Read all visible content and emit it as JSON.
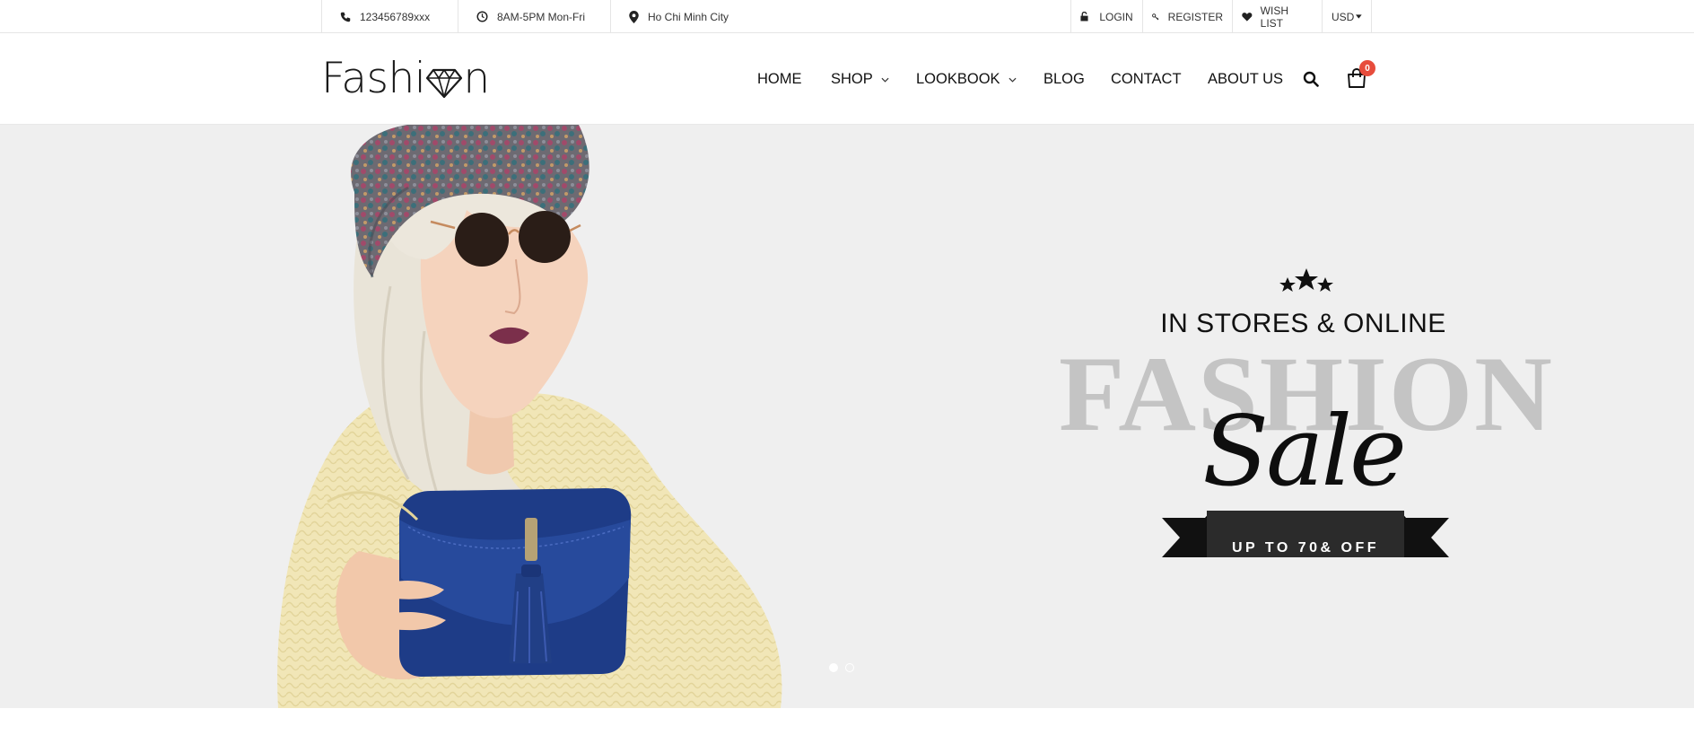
{
  "topbar": {
    "phone": "123456789xxx",
    "hours": "8AM-5PM Mon-Fri",
    "location": "Ho Chi Minh City",
    "login": "LOGIN",
    "register": "REGISTER",
    "wishlist": "WISH LIST",
    "currency": "USD"
  },
  "header": {
    "logo_left": "Fashi",
    "logo_right": "n",
    "nav": {
      "home": "HOME",
      "shop": "SHOP",
      "lookbook": "LOOKBOOK",
      "blog": "BLOG",
      "contact": "CONTACT",
      "about": "ABOUT US"
    },
    "cart_count": "0"
  },
  "hero": {
    "tagline": "IN STORES & ONLINE",
    "big_word": "FASHION",
    "script": "Sale",
    "ribbon": "UP TO 70& OFF",
    "slides": 2,
    "active_slide": 1
  },
  "colors": {
    "badge": "#e74c3c",
    "hero_bg": "#efefef",
    "ribbon": "#111111"
  }
}
